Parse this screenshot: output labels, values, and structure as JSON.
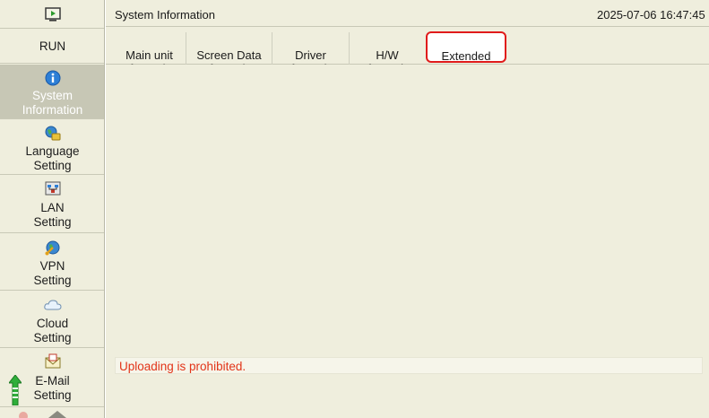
{
  "sidebar": {
    "items": [
      {
        "label": "",
        "icon": "monitor-play-icon"
      },
      {
        "label": "RUN",
        "icon": ""
      },
      {
        "label": "System\nInformation",
        "icon": "info-icon"
      },
      {
        "label": "Language\nSetting",
        "icon": "globe-book-icon"
      },
      {
        "label": "LAN\nSetting",
        "icon": "network-icon"
      },
      {
        "label": "VPN\nSetting",
        "icon": "vpn-key-icon"
      },
      {
        "label": "Cloud\nSetting",
        "icon": "cloud-icon"
      },
      {
        "label": "E-Mail\nSetting",
        "icon": "mail-icon"
      }
    ],
    "scroll_up_icon": "green-up-arrow-icon"
  },
  "header": {
    "title": "System Information",
    "datetime": "2025-07-06  16:47:45"
  },
  "tabs": [
    {
      "label": "Main unit\nInformation"
    },
    {
      "label": "Screen Data\nInformation"
    },
    {
      "label": "Driver\nInformation"
    },
    {
      "label": "H/W\nInformation"
    },
    {
      "label": "Extended\nInformation",
      "selected": true
    }
  ],
  "status": {
    "message": "Uploading is prohibited."
  },
  "colors": {
    "accent": "#e01b1b",
    "panel": "#efeedd",
    "status_text": "#e23418"
  }
}
